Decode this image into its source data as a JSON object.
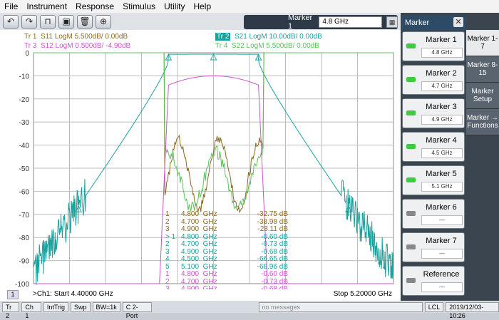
{
  "menu": [
    "File",
    "Instrument",
    "Response",
    "Stimulus",
    "Utility",
    "Help"
  ],
  "toolbar_icons": [
    "undo-icon",
    "redo-icon",
    "marker-add-icon",
    "screenshot-icon",
    "trash-icon",
    "zoom-icon"
  ],
  "marker_entry": {
    "label": "Marker 1",
    "value": "4.8 GHz"
  },
  "traces": {
    "tr1": {
      "id": "Tr  1",
      "text": "S11 LogM 5.500dB/  0.00dB",
      "color": "#8a6a20"
    },
    "tr2": {
      "id": "Tr  2",
      "text": "S21 LogM 10.00dB/  0.00dB",
      "color": "#1aa39e"
    },
    "tr3": {
      "id": "Tr  3",
      "text": "S12 LogM 0.500dB/  -4.90dB",
      "color": "#cc55cc"
    },
    "tr4": {
      "id": "Tr  4",
      "text": "S22 LogM 5.500dB/  0.00dB",
      "color": "#58c458"
    }
  },
  "chart_data": {
    "type": "line",
    "ylim": [
      -100,
      0
    ],
    "yticks": [
      "0",
      "-10",
      "-20",
      "-30",
      "-40",
      "-50",
      "-60",
      "-70",
      "-80",
      "-90",
      "-100"
    ],
    "x_start_ghz": 4.4,
    "x_stop_ghz": 5.2,
    "grid": true
  },
  "marker_table": [
    {
      "m": "1",
      "f": "4.800  GHz",
      "v": "-32.75 dB",
      "color": "#8a6a20"
    },
    {
      "m": "2",
      "f": "4.700  GHz",
      "v": "-38.98 dB",
      "color": "#8a6a20"
    },
    {
      "m": "3",
      "f": "4.900  GHz",
      "v": "-28.11 dB",
      "color": "#8a6a20"
    },
    {
      "m": "> 1",
      "f": "4.800  GHz",
      "v": "-0.60 dB",
      "color": "#1aa39e"
    },
    {
      "m": "2",
      "f": "4.700  GHz",
      "v": "-0.73 dB",
      "color": "#1aa39e"
    },
    {
      "m": "3",
      "f": "4.900  GHz",
      "v": "-0.68 dB",
      "color": "#1aa39e"
    },
    {
      "m": "4",
      "f": "4.500  GHz",
      "v": "-66.65 dB",
      "color": "#1aa39e"
    },
    {
      "m": "5",
      "f": "5.100  GHz",
      "v": "-68.96 dB",
      "color": "#1aa39e"
    },
    {
      "m": "1",
      "f": "4.800  GHz",
      "v": "-0.60 dB",
      "color": "#cc55cc"
    },
    {
      "m": "2",
      "f": "4.700  GHz",
      "v": "-0.73 dB",
      "color": "#cc55cc"
    },
    {
      "m": "3",
      "f": "4.900  GHz",
      "v": "-0.68 dB",
      "color": "#cc55cc"
    }
  ],
  "status": {
    "ch_num": "1",
    "start": ">Ch1:  Start  4.40000 GHz",
    "stop": "Stop  5.20000 GHz"
  },
  "panel": {
    "title": "Marker",
    "close": "✕"
  },
  "marker_buttons": [
    {
      "label": "Marker 1",
      "value": "4.8 GHz",
      "on": true
    },
    {
      "label": "Marker 2",
      "value": "4.7 GHz",
      "on": true
    },
    {
      "label": "Marker 3",
      "value": "4.9 GHz",
      "on": true
    },
    {
      "label": "Marker 4",
      "value": "4.5 GHz",
      "on": true
    },
    {
      "label": "Marker 5",
      "value": "5.1 GHz",
      "on": true
    },
    {
      "label": "Marker 6",
      "value": "---",
      "on": false
    },
    {
      "label": "Marker 7",
      "value": "---",
      "on": false
    },
    {
      "label": "Reference",
      "value": "---",
      "on": false
    }
  ],
  "side_tabs": [
    "Marker 1-7",
    "Marker 8-15",
    "Marker Setup",
    "Marker → Functions"
  ],
  "bottom": [
    "Tr 2",
    "Ch 1",
    "IntTrig",
    "Swp",
    "BW=1k",
    "C  2-Port",
    "no messages",
    "LCL",
    "2019/12/03-10:26"
  ]
}
